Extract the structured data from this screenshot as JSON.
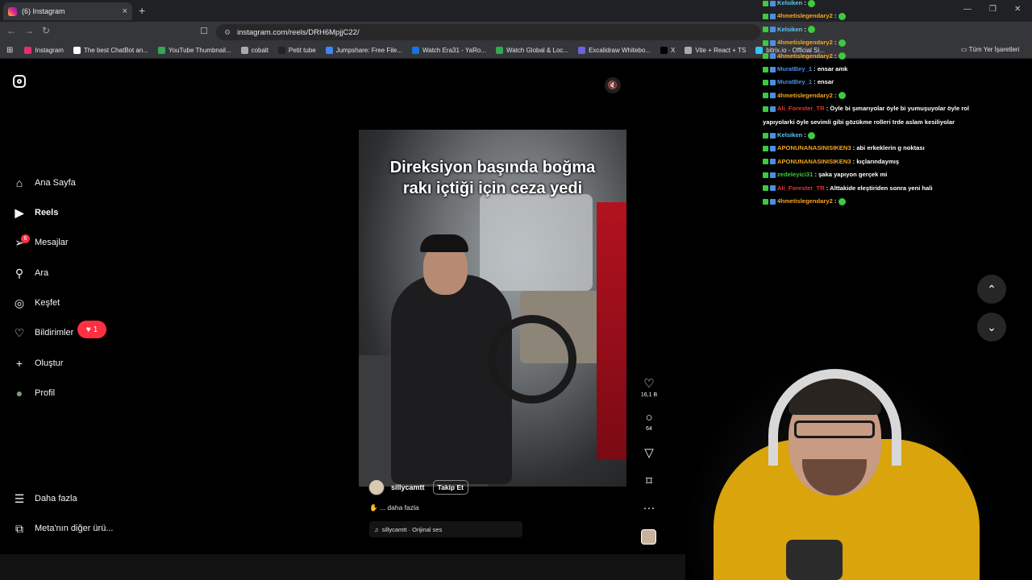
{
  "browser": {
    "tab_title": "(6) Instagram",
    "url": "instagram.com/reels/DRH6MpjjC22/",
    "bookmarks": [
      {
        "label": "Instagram",
        "color": "#e1306c"
      },
      {
        "label": "The best ChatBot an...",
        "color": "#ffffff"
      },
      {
        "label": "YouTube Thumbnail...",
        "color": "#34a853"
      },
      {
        "label": "cobalt",
        "color": "#aaaaaa"
      },
      {
        "label": "Petit tube",
        "color": "#222222"
      },
      {
        "label": "Jumpshare: Free File...",
        "color": "#4285f4"
      },
      {
        "label": "Watch Era31 - YaRo...",
        "color": "#1a73e8"
      },
      {
        "label": "Watch Global & Loc...",
        "color": "#34a853"
      },
      {
        "label": "Excalidraw Whitebo...",
        "color": "#6965db"
      },
      {
        "label": "X",
        "color": "#000000"
      },
      {
        "label": "Vite + React + TS",
        "color": "#aaaaaa"
      },
      {
        "label": "bitrix.io - Official Si...",
        "color": "#2fc6f6"
      }
    ],
    "all_bookmarks": "Tüm Yer İşaretleri"
  },
  "sidebar": {
    "items": [
      {
        "label": "Ana Sayfa",
        "icon": "⌂"
      },
      {
        "label": "Reels",
        "icon": "▶"
      },
      {
        "label": "Mesajlar",
        "icon": "➢"
      },
      {
        "label": "Ara",
        "icon": "⚲"
      },
      {
        "label": "Keşfet",
        "icon": "◎"
      },
      {
        "label": "Bildirimler",
        "icon": "♡"
      },
      {
        "label": "Oluştur",
        "icon": "+"
      },
      {
        "label": "Profil",
        "icon": "●"
      }
    ],
    "notif_count": "1",
    "messages_count": "6",
    "more_label": "Daha fazla",
    "meta_label": "Meta'nın diğer ürü..."
  },
  "reel": {
    "caption_line1": "Direksiyon başında boğma",
    "caption_line2": "rakı içtiği için ceza yedi",
    "author": "sillycamtt",
    "follow_label": "Takip Et",
    "more_text": "... daha fazla",
    "audio_text": "sillycamtt · Orijinal ses",
    "likes": "16,1 B",
    "comments": "64"
  },
  "chat": [
    {
      "user": "Kelsiken",
      "color": "#5bc8f5",
      "text": "",
      "emote": true
    },
    {
      "user": "4hmetislegendary2",
      "color": "#f5a623",
      "text": "",
      "emote": true
    },
    {
      "user": "Kelsiken",
      "color": "#5bc8f5",
      "text": "",
      "emote": true
    },
    {
      "user": "4hmetislegendary2",
      "color": "#f5a623",
      "text": "",
      "emote": true
    },
    {
      "user": "4hmetislegendary2",
      "color": "#f5a623",
      "text": "",
      "emote": true
    },
    {
      "user": "MuratBey_1",
      "color": "#4a90e2",
      "text": "ensar amk",
      "emote": false
    },
    {
      "user": "MuratBey_1",
      "color": "#4a90e2",
      "text": "ensar",
      "emote": false
    },
    {
      "user": "4hmetislegendary2",
      "color": "#f5a623",
      "text": "",
      "emote": true
    },
    {
      "user": "Ali_Forester_TR",
      "color": "#e0352b",
      "text": "Öyle bi şımarıyolar öyle bi yumuşuyolar öyle rol",
      "emote": false
    },
    {
      "user": "",
      "color": "#ffffff",
      "text": "yapıyolarki öyle sevimli gibi gözükme rolleri trde aslam kesiliyolar",
      "emote": false
    },
    {
      "user": "Kelsiken",
      "color": "#5bc8f5",
      "text": "",
      "emote": true
    },
    {
      "user": "APONUNANASINISIKEN3",
      "color": "#f5a623",
      "text": "abi erkeklerin g noktası",
      "emote": false
    },
    {
      "user": "APONUNANASINISIKEN3",
      "color": "#f5a623",
      "text": "kıçlarındaymış",
      "emote": false
    },
    {
      "user": "zedeleyici31",
      "color": "#3ec93e",
      "text": "şaka yapıyon gerçek mi",
      "emote": false
    },
    {
      "user": "Ali_Forester_TR",
      "color": "#e0352b",
      "text": "Alttakide eleştiriden sonra yeni hali",
      "emote": false
    },
    {
      "user": "4hmetislegendary2",
      "color": "#f5a623",
      "text": "",
      "emote": true
    }
  ]
}
